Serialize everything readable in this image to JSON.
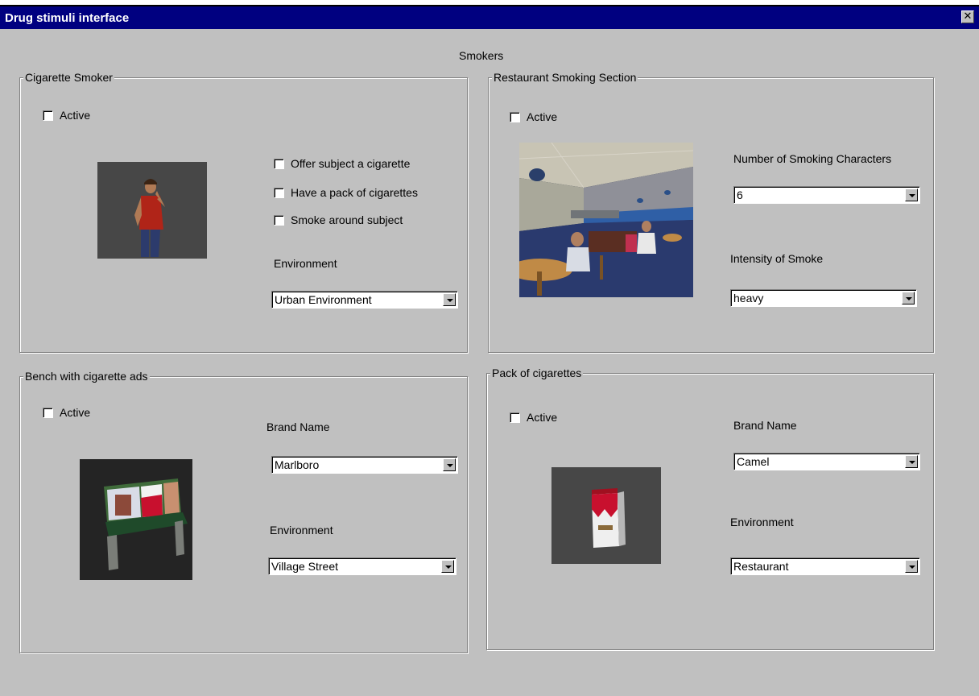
{
  "window": {
    "title": "Drug stimuli interface",
    "close_glyph": "✕"
  },
  "heading": "Smokers",
  "cigarette_smoker": {
    "legend": "Cigarette Smoker",
    "active_label": "Active",
    "options": [
      "Offer subject a cigarette",
      "Have a pack of cigarettes",
      "Smoke around subject"
    ],
    "environment_label": "Environment",
    "environment_value": "Urban Environment"
  },
  "restaurant": {
    "legend": "Restaurant Smoking Section",
    "active_label": "Active",
    "num_label": "Number of Smoking Characters",
    "num_value": "6",
    "intensity_label": "Intensity of Smoke",
    "intensity_value": "heavy"
  },
  "bench": {
    "legend": "Bench with cigarette ads",
    "active_label": "Active",
    "brand_label": "Brand Name",
    "brand_value": "Marlboro",
    "environment_label": "Environment",
    "environment_value": "Village Street"
  },
  "pack": {
    "legend": "Pack of cigarettes",
    "active_label": "Active",
    "brand_label": "Brand Name",
    "brand_value": "Camel",
    "environment_label": "Environment",
    "environment_value": "Restaurant"
  }
}
